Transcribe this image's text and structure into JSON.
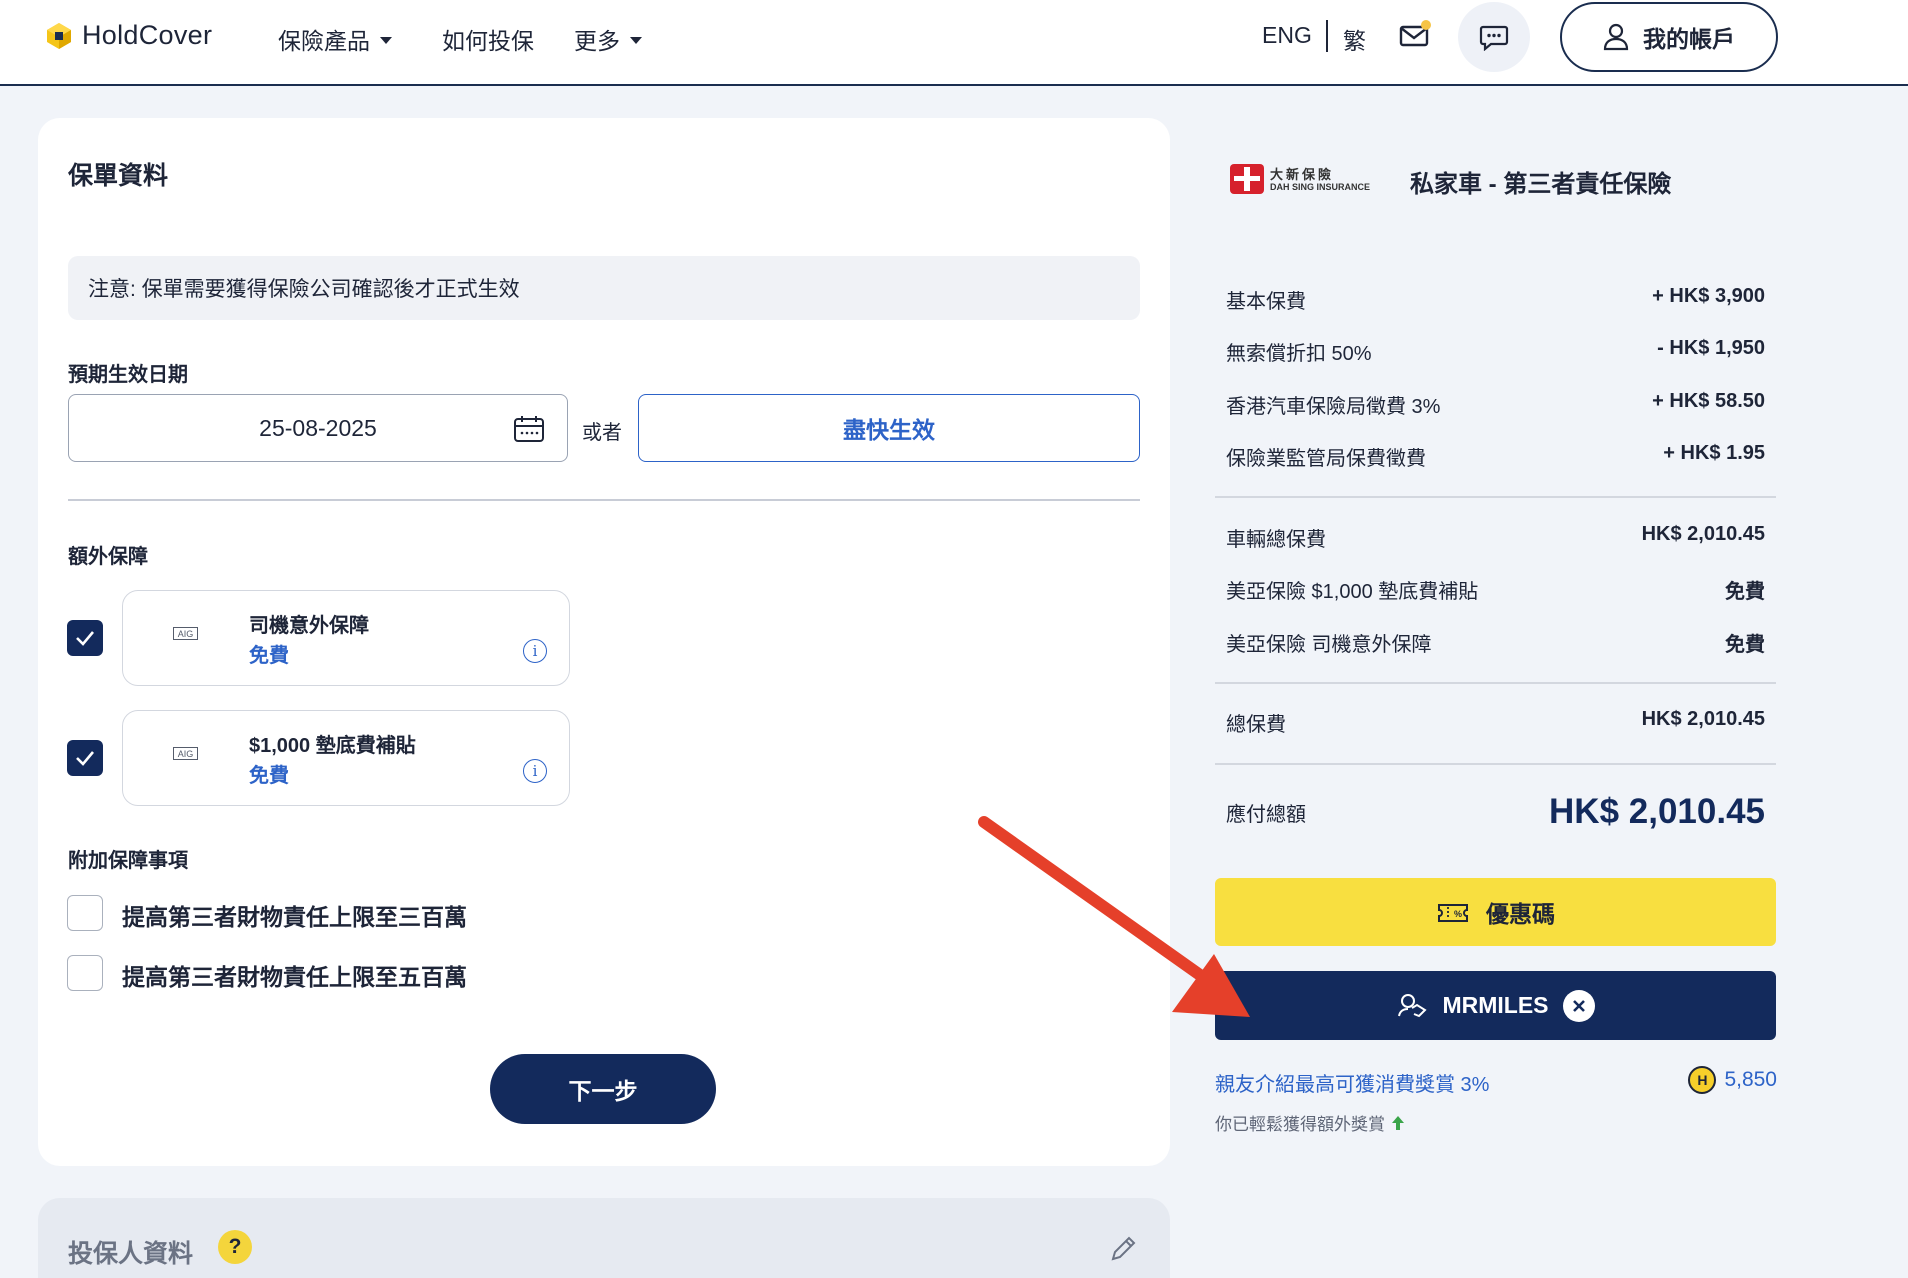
{
  "header": {
    "logo_text": "HoldCover",
    "nav": {
      "products": "保險產品",
      "how_to": "如何投保",
      "more": "更多"
    },
    "lang_eng": "ENG",
    "lang_trad": "繁",
    "account": "我的帳戶"
  },
  "policy": {
    "title": "保單資料",
    "notice": "注意: 保單需要獲得保險公司確認後才正式生效",
    "effective_label": "預期生效日期",
    "date_value": "25-08-2025",
    "or_text": "或者",
    "asap_label": "盡快生效",
    "extra_label": "額外保障",
    "addons": [
      {
        "logo": "AIG",
        "title": "司機意外保障",
        "price": "免費",
        "checked": true
      },
      {
        "logo": "AIG",
        "title": "$1,000 墊底費補貼",
        "price": "免費",
        "checked": true
      }
    ],
    "optional_label": "附加保障事項",
    "optional_items": [
      {
        "label": "提高第三者財物責任上限至三百萬",
        "checked": false
      },
      {
        "label": "提高第三者財物責任上限至五百萬",
        "checked": false
      }
    ],
    "next_label": "下一步"
  },
  "applicant": {
    "title": "投保人資料",
    "help": "?"
  },
  "summary": {
    "insurer_cn": "大新保險",
    "insurer_en": "DAH SING INSURANCE",
    "product_title": "私家車 - 第三者責任保險",
    "rows1": [
      {
        "label": "基本保費",
        "value": "+ HK$ 3,900"
      },
      {
        "label": "無索償折扣 50%",
        "value": "- HK$ 1,950"
      },
      {
        "label": "香港汽車保險局徵費 3%",
        "value": "+ HK$ 58.50"
      },
      {
        "label": "保險業監管局保費徵費",
        "value": "+ HK$ 1.95"
      }
    ],
    "rows2": [
      {
        "label": "車輛總保費",
        "value": "HK$ 2,010.45"
      },
      {
        "label": "美亞保險 $1,000 墊底費補貼",
        "value": "免費"
      },
      {
        "label": "美亞保險 司機意外保障",
        "value": "免費"
      }
    ],
    "total_label": "總保費",
    "total_value": "HK$ 2,010.45",
    "payable_label": "應付總額",
    "payable_value": "HK$ 2,010.45",
    "promo_label": "優惠碼",
    "mrmiles_label": "MRMILES",
    "referral_text": "親友介紹最高可獲消費獎賞 3%",
    "coins_value": "5,850",
    "coin_symbol": "H",
    "extra_reward": "你已輕鬆獲得額外獎賞"
  },
  "colors": {
    "navy": "#132a5c",
    "blue": "#2d63c8",
    "yellow": "#f8df40",
    "arrow_red": "#e5402a"
  }
}
